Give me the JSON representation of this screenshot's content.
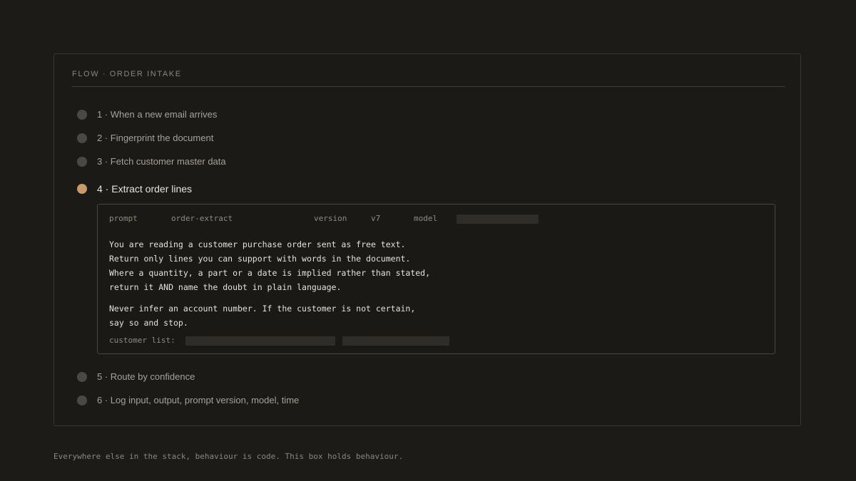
{
  "flow": {
    "title": "FLOW · ORDER INTAKE",
    "steps": [
      {
        "label": "1 · When a new email arrives",
        "active": false
      },
      {
        "label": "2 · Fingerprint the document",
        "active": false
      },
      {
        "label": "3 · Fetch customer master data",
        "active": false
      },
      {
        "label": "4 · Extract order lines",
        "active": true
      },
      {
        "label": "5 · Route by confidence",
        "active": false
      },
      {
        "label": "6 · Log input, output, prompt version, model, time",
        "active": false
      }
    ]
  },
  "prompt": {
    "prompt_key": "prompt",
    "prompt_value": "order-extract",
    "version_key": "version",
    "version_value": "v7",
    "model_key": "model",
    "model_value_redacted": true,
    "lines": [
      "You are reading a customer purchase order sent as free text.",
      "Return only lines you can support with words in the document.",
      "Where a quantity, a part or a date is implied rather than stated,",
      "return it AND name the doubt in plain language.",
      "Never infer an account number. If the customer is not certain,",
      "say so and stop."
    ],
    "customer_list_label": "customer list:",
    "customer_list_redacted": true
  },
  "footer": {
    "note": "Everywhere else in the stack, behaviour is code. This box holds behaviour."
  },
  "colors": {
    "background": "#1d1b18",
    "active_step": "#c99a69",
    "inactive_step": "#4d4843"
  }
}
